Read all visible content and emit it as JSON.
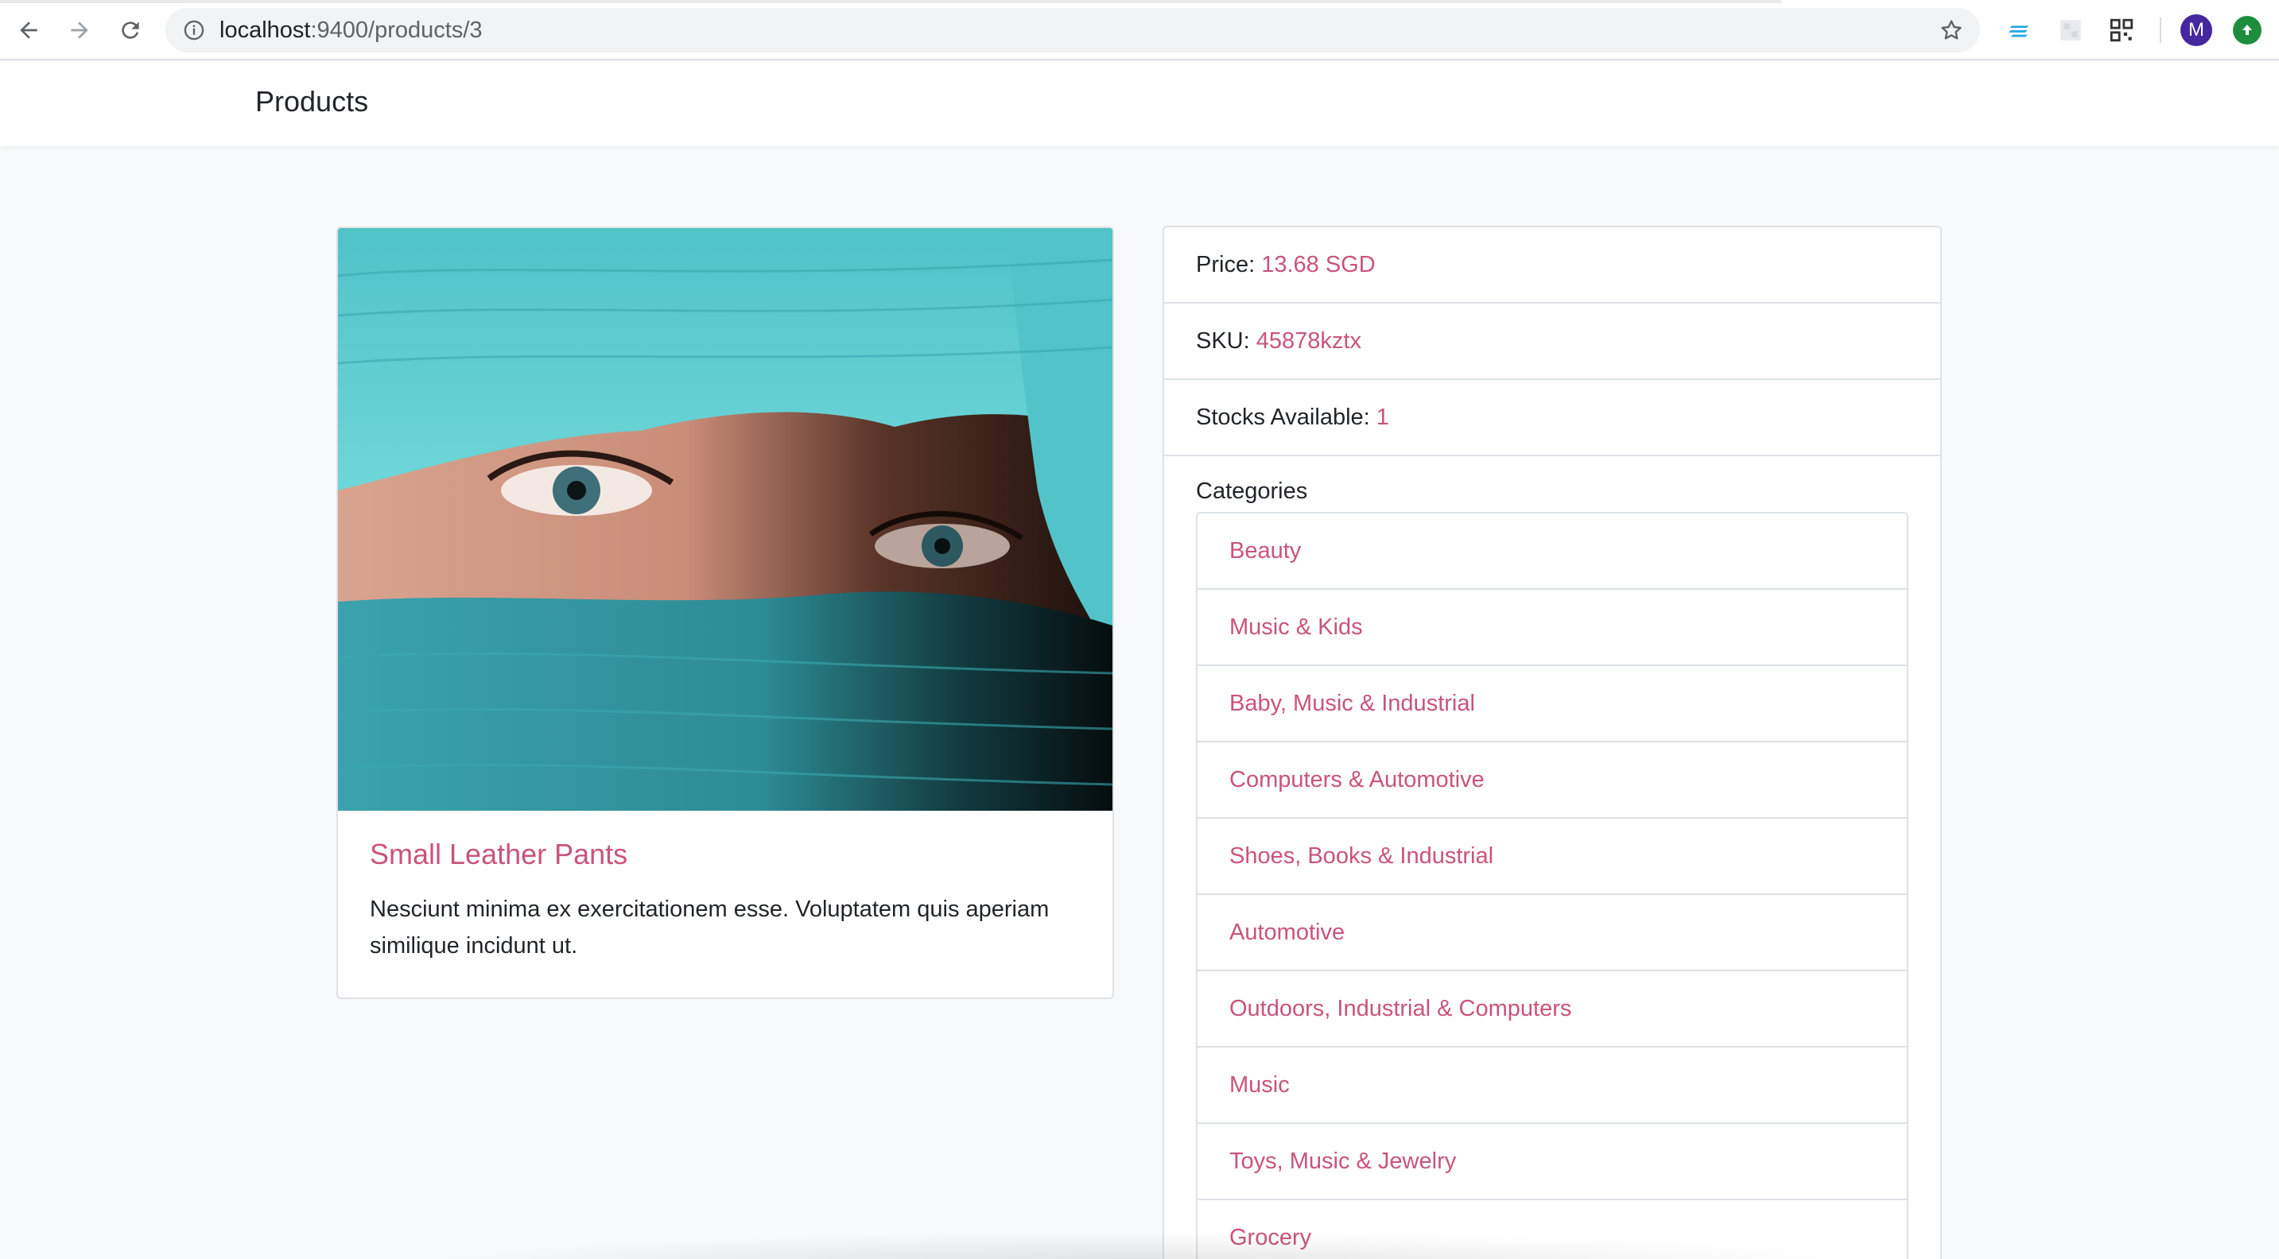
{
  "browser": {
    "url_host": "localhost",
    "url_path": ":9400/products/3",
    "avatar_initial": "M",
    "icons": [
      "back-arrow-icon",
      "forward-arrow-icon",
      "reload-icon",
      "info-icon",
      "bookmark-star-icon",
      "extension-icon",
      "qr-code-icon",
      "update-icon"
    ]
  },
  "navbar": {
    "brand": "Products"
  },
  "product": {
    "name": "Small Leather Pants",
    "description": "Nesciunt minima ex exercitationem esse. Voluptatem quis aperiam similique incidunt ut.",
    "image_alt": "Close-up of eyes above a turquoise scarf"
  },
  "details": {
    "price_label": "Price: ",
    "price_value": "13.68 SGD",
    "sku_label": "SKU: ",
    "sku_value": "45878kztx",
    "stock_label": "Stocks Available: ",
    "stock_value": "1",
    "categories_title": "Categories",
    "categories": [
      "Beauty",
      "Music & Kids",
      "Baby, Music & Industrial",
      "Computers & Automotive",
      "Shoes, Books & Industrial",
      "Automotive",
      "Outdoors, Industrial & Computers",
      "Music",
      "Toys, Music & Jewelry",
      "Grocery"
    ]
  },
  "colors": {
    "accent": "#c9547a",
    "background": "#f8f9fa",
    "border": "#dee2e6"
  }
}
